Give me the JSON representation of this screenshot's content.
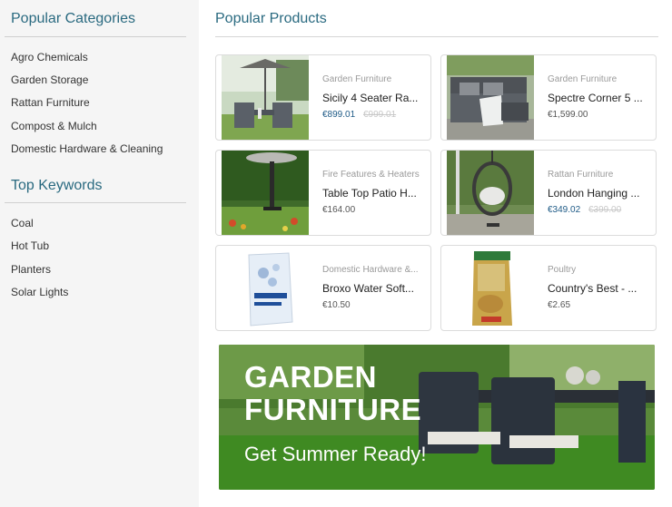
{
  "sidebar": {
    "categories_title": "Popular Categories",
    "categories": [
      "Agro Chemicals",
      "Garden Storage",
      "Rattan Furniture",
      "Compost & Mulch",
      "Domestic Hardware & Cleaning"
    ],
    "keywords_title": "Top Keywords",
    "keywords": [
      "Coal",
      "Hot Tub",
      "Planters",
      "Solar Lights"
    ]
  },
  "main": {
    "title": "Popular Products",
    "products": [
      {
        "category": "Garden Furniture",
        "name": "Sicily 4 Seater Ra...",
        "price": "€899.01",
        "old_price": "€999.01"
      },
      {
        "category": "Garden Furniture",
        "name": "Spectre Corner 5 ...",
        "price": "€1,599.00",
        "old_price": ""
      },
      {
        "category": "Fire Features & Heaters",
        "name": "Table Top Patio H...",
        "price": "€164.00",
        "old_price": ""
      },
      {
        "category": "Rattan Furniture",
        "name": "London Hanging ...",
        "price": "€349.02",
        "old_price": "€399.00"
      },
      {
        "category": "Domestic Hardware &...",
        "name": "Broxo Water Soft...",
        "price": "€10.50",
        "old_price": ""
      },
      {
        "category": "Poultry",
        "name": "Country's Best - ...",
        "price": "€2.65",
        "old_price": ""
      }
    ],
    "banner": {
      "line1": "GARDEN",
      "line2": "FURNITURE",
      "line3": "Get Summer Ready!"
    }
  },
  "colors": {
    "heading": "#2a6a80",
    "sale_price": "#1e5a86",
    "sidebar_bg": "#f5f5f5"
  }
}
